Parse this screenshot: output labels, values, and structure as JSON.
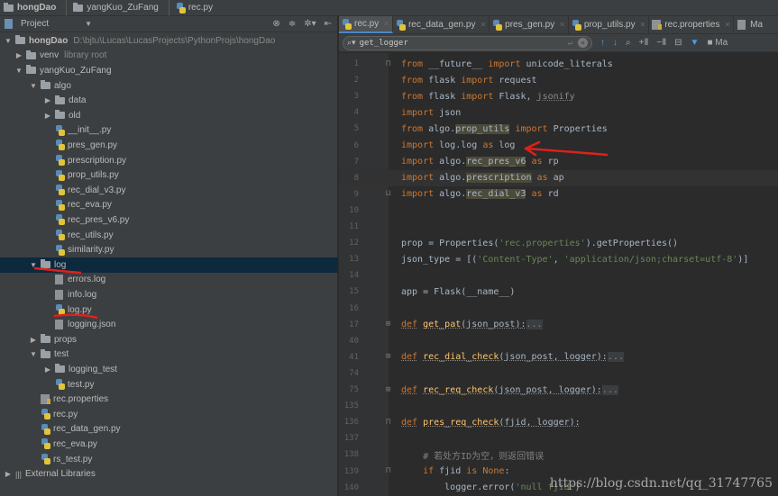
{
  "navbar": {
    "crumbs": [
      "hongDao",
      "yangKuo_ZuFang",
      "rec.py"
    ]
  },
  "project_panel": {
    "title": "Project",
    "tree": [
      {
        "label": "hongDao",
        "hint": "D:\\bjtu\\Lucas\\LucasProjects\\PythonProjs\\hongDao",
        "type": "folder",
        "level": 0,
        "expanded": true,
        "bold": true
      },
      {
        "label": "venv",
        "hint": "library root",
        "type": "folder",
        "level": 1,
        "expanded": false
      },
      {
        "label": "yangKuo_ZuFang",
        "type": "folder",
        "level": 1,
        "expanded": true
      },
      {
        "label": "algo",
        "type": "folder",
        "level": 2,
        "expanded": true
      },
      {
        "label": "data",
        "type": "folder",
        "level": 3,
        "expanded": false
      },
      {
        "label": "old",
        "type": "folder",
        "level": 3,
        "expanded": false
      },
      {
        "label": "__init__.py",
        "type": "py",
        "level": 3
      },
      {
        "label": "pres_gen.py",
        "type": "py",
        "level": 3
      },
      {
        "label": "prescription.py",
        "type": "py",
        "level": 3
      },
      {
        "label": "prop_utils.py",
        "type": "py",
        "level": 3
      },
      {
        "label": "rec_dial_v3.py",
        "type": "py",
        "level": 3
      },
      {
        "label": "rec_eva.py",
        "type": "py",
        "level": 3
      },
      {
        "label": "rec_pres_v6.py",
        "type": "py",
        "level": 3
      },
      {
        "label": "rec_utils.py",
        "type": "py",
        "level": 3
      },
      {
        "label": "similarity.py",
        "type": "py",
        "level": 3
      },
      {
        "label": "log",
        "type": "folder",
        "level": 2,
        "expanded": true,
        "selected": true
      },
      {
        "label": "errors.log",
        "type": "file",
        "level": 3
      },
      {
        "label": "info.log",
        "type": "file",
        "level": 3
      },
      {
        "label": "log.py",
        "type": "py",
        "level": 3
      },
      {
        "label": "logging.json",
        "type": "file",
        "level": 3
      },
      {
        "label": "props",
        "type": "folder",
        "level": 2,
        "expanded": false
      },
      {
        "label": "test",
        "type": "folder",
        "level": 2,
        "expanded": true
      },
      {
        "label": "logging_test",
        "type": "folder",
        "level": 3,
        "expanded": false
      },
      {
        "label": "test.py",
        "type": "py",
        "level": 3
      },
      {
        "label": "rec.properties",
        "type": "prop",
        "level": 2
      },
      {
        "label": "rec.py",
        "type": "py",
        "level": 2
      },
      {
        "label": "rec_data_gen.py",
        "type": "py",
        "level": 2
      },
      {
        "label": "rec_eva.py",
        "type": "py",
        "level": 2
      },
      {
        "label": "rs_test.py",
        "type": "py",
        "level": 2
      },
      {
        "label": "External Libraries",
        "type": "lib",
        "level": 0,
        "expanded": false
      }
    ]
  },
  "editor": {
    "tabs": [
      {
        "label": "rec.py",
        "icon": "py",
        "active": true
      },
      {
        "label": "rec_data_gen.py",
        "icon": "py"
      },
      {
        "label": "pres_gen.py",
        "icon": "py"
      },
      {
        "label": "prop_utils.py",
        "icon": "py"
      },
      {
        "label": "rec.properties",
        "icon": "prop"
      },
      {
        "label": "Ma",
        "icon": "file"
      }
    ],
    "search": {
      "value": "get_logger"
    },
    "lines": [
      {
        "n": "1",
        "fold": "open",
        "t": [
          [
            "from",
            "kw"
          ],
          [
            " __future__ ",
            "id"
          ],
          [
            "import",
            "kw"
          ],
          [
            " unicode_literals",
            "id"
          ]
        ]
      },
      {
        "n": "2",
        "t": [
          [
            "from",
            "kw"
          ],
          [
            " flask ",
            "id"
          ],
          [
            "import",
            "kw"
          ],
          [
            " request",
            "id"
          ]
        ]
      },
      {
        "n": "3",
        "t": [
          [
            "from",
            "kw"
          ],
          [
            " flask ",
            "id"
          ],
          [
            "import",
            "kw"
          ],
          [
            " Flask, ",
            "id"
          ],
          [
            "jsonify",
            "dim"
          ]
        ]
      },
      {
        "n": "4",
        "t": [
          [
            "import",
            "kw"
          ],
          [
            " json",
            "id"
          ]
        ]
      },
      {
        "n": "5",
        "t": [
          [
            "from",
            "kw"
          ],
          [
            " algo.",
            "id"
          ],
          [
            "prop_utils",
            "hl"
          ],
          [
            " import",
            "kw"
          ],
          [
            " Properties",
            "id"
          ]
        ]
      },
      {
        "n": "6",
        "t": [
          [
            "import",
            "kw"
          ],
          [
            " log.log ",
            "id"
          ],
          [
            "as",
            "kw"
          ],
          [
            " log",
            "id"
          ]
        ]
      },
      {
        "n": "7",
        "t": [
          [
            "import",
            "kw"
          ],
          [
            " algo.",
            "id"
          ],
          [
            "rec_pres_v6",
            "hl"
          ],
          [
            " as",
            "kw"
          ],
          [
            " rp",
            "id"
          ]
        ]
      },
      {
        "n": "8",
        "cur": true,
        "t": [
          [
            "import",
            "kw"
          ],
          [
            " algo.",
            "id"
          ],
          [
            "prescription",
            "hl"
          ],
          [
            " as",
            "kw"
          ],
          [
            " ap",
            "id"
          ]
        ]
      },
      {
        "n": "9",
        "fold": "close",
        "t": [
          [
            "import",
            "kw"
          ],
          [
            " algo.",
            "id"
          ],
          [
            "rec_dial_v3",
            "hl"
          ],
          [
            " as",
            "kw"
          ],
          [
            " rd",
            "id"
          ]
        ]
      },
      {
        "n": "10",
        "t": []
      },
      {
        "n": "11",
        "t": []
      },
      {
        "n": "12",
        "t": [
          [
            "prop = Properties(",
            "id"
          ],
          [
            "'rec.properties'",
            "str"
          ],
          [
            ").getProperties()",
            "id"
          ]
        ]
      },
      {
        "n": "13",
        "t": [
          [
            "json_type = [(",
            "id"
          ],
          [
            "'Content-Type'",
            "str"
          ],
          [
            ", ",
            "id"
          ],
          [
            "'application/json;charset=utf-8'",
            "str"
          ],
          [
            ")]",
            "id"
          ]
        ]
      },
      {
        "n": "14",
        "t": []
      },
      {
        "n": "15",
        "t": [
          [
            "app = Flask(__name__)",
            "id"
          ]
        ]
      },
      {
        "n": "16",
        "t": []
      },
      {
        "n": "17",
        "fold": "plus",
        "t": [
          [
            "def",
            "kwu"
          ],
          [
            " ",
            "id"
          ],
          [
            "get_pat",
            "fn"
          ],
          [
            "(json_post):",
            "idu"
          ],
          [
            "...",
            "collapsed"
          ]
        ]
      },
      {
        "n": "40",
        "t": []
      },
      {
        "n": "41",
        "fold": "plus",
        "t": [
          [
            "def",
            "kwu"
          ],
          [
            " ",
            "id"
          ],
          [
            "rec_dial_check",
            "fn"
          ],
          [
            "(json_post, logger):",
            "idu"
          ],
          [
            "...",
            "collapsed"
          ]
        ]
      },
      {
        "n": "74",
        "t": []
      },
      {
        "n": "75",
        "fold": "plus",
        "t": [
          [
            "def",
            "kwu"
          ],
          [
            " ",
            "id"
          ],
          [
            "rec_req_check",
            "fn"
          ],
          [
            "(json_post, logger):",
            "idu"
          ],
          [
            "...",
            "collapsed"
          ]
        ]
      },
      {
        "n": "135",
        "t": []
      },
      {
        "n": "136",
        "fold": "open",
        "t": [
          [
            "def",
            "kwu"
          ],
          [
            " ",
            "id"
          ],
          [
            "pres_req_check",
            "fn"
          ],
          [
            "(fjid, logger):",
            "idu"
          ]
        ]
      },
      {
        "n": "137",
        "t": []
      },
      {
        "n": "138",
        "t": [
          [
            "    # 若处方ID为空，则返回错误",
            "cm"
          ]
        ]
      },
      {
        "n": "139",
        "fold": "open",
        "t": [
          [
            "    ",
            "id"
          ],
          [
            "if",
            "kw"
          ],
          [
            " fjid ",
            "id"
          ],
          [
            "is",
            "kw"
          ],
          [
            " ",
            "id"
          ],
          [
            "None",
            "kw"
          ],
          [
            ":",
            "id"
          ]
        ]
      },
      {
        "n": "140",
        "t": [
          [
            "        logger.error(",
            "id"
          ],
          [
            "'null fjid'",
            "str"
          ],
          [
            ")",
            "id"
          ]
        ]
      }
    ]
  },
  "watermark": "https://blog.csdn.net/qq_31747765",
  "colors": {
    "panel": "#3c3f41",
    "editor": "#2b2b2b",
    "selection": "#0d293e",
    "keyword": "#cc7832",
    "string": "#6a8759",
    "annotation": "#e0201a"
  }
}
